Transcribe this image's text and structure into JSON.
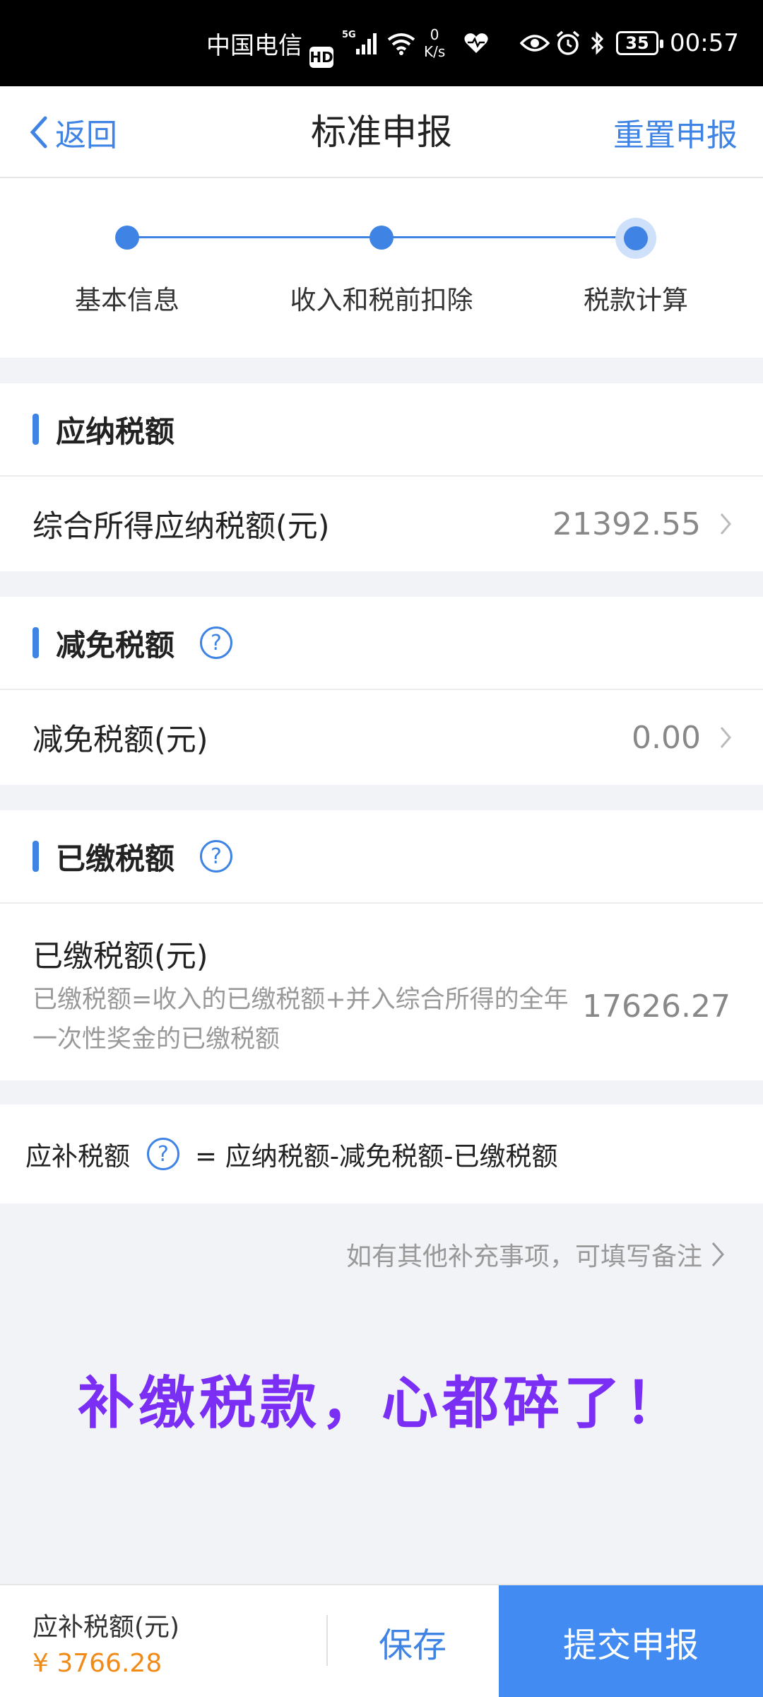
{
  "status_bar": {
    "carrier": "中国电信",
    "hd": "HD",
    "speed_value": "0",
    "speed_unit": "K/s",
    "battery": "35",
    "time": "00:57"
  },
  "nav": {
    "back_label": "返回",
    "title": "标准申报",
    "reset_label": "重置申报"
  },
  "steps": [
    {
      "label": "基本信息"
    },
    {
      "label": "收入和税前扣除"
    },
    {
      "label": "税款计算"
    }
  ],
  "tax_payable": {
    "title": "应纳税额",
    "row_label": "综合所得应纳税额(元)",
    "row_value": "21392.55"
  },
  "tax_relief": {
    "title": "减免税额",
    "row_label": "减免税额(元)",
    "row_value": "0.00"
  },
  "tax_paid": {
    "title": "已缴税额",
    "row_label": "已缴税额(元)",
    "row_desc": "已缴税额=收入的已缴税额+并入综合所得的全年一次性奖金的已缴税额",
    "row_value": "17626.27"
  },
  "supplement": {
    "label": "应补税额",
    "formula": "= 应纳税额-减免税额-已缴税额"
  },
  "remark_link": "如有其他补充事项，可填写备注",
  "overlay_caption": "补缴税款，心都碎了！",
  "bottom": {
    "label": "应补税额(元)",
    "amount": "¥ 3766.28",
    "save_label": "保存",
    "submit_label": "提交申报"
  },
  "colors": {
    "accent": "#3f84e4",
    "amount": "#f08a18",
    "caption": "#7b2ff5"
  }
}
